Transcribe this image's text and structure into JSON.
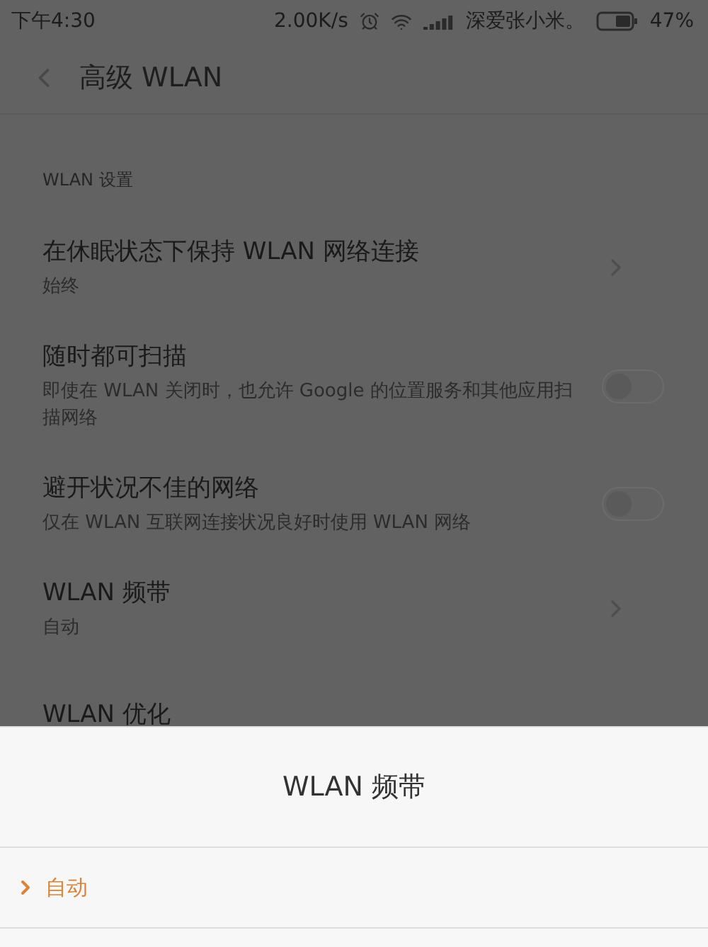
{
  "status_bar": {
    "time": "下午4:30",
    "speed": "2.00K/s",
    "carrier": "深爱张小米。",
    "battery": "47%"
  },
  "header": {
    "title": "高级 WLAN"
  },
  "section": {
    "label": "WLAN 设置"
  },
  "settings": [
    {
      "kind": "link",
      "title": "在休眠状态下保持 WLAN 网络连接",
      "subtitle": "始终"
    },
    {
      "kind": "toggle",
      "title": "随时都可扫描",
      "subtitle": "即使在 WLAN 关闭时，也允许 Google 的位置服务和其他应用扫描网络",
      "on": false
    },
    {
      "kind": "toggle",
      "title": "避开状况不佳的网络",
      "subtitle": "仅在 WLAN 互联网连接状况良好时使用 WLAN 网络",
      "on": false
    },
    {
      "kind": "link",
      "title": "WLAN 频带",
      "subtitle": "自动"
    },
    {
      "kind": "link",
      "title": "WLAN 优化"
    }
  ],
  "sheet": {
    "title": "WLAN 频带",
    "options": [
      {
        "label": "自动",
        "selected": true
      }
    ]
  }
}
